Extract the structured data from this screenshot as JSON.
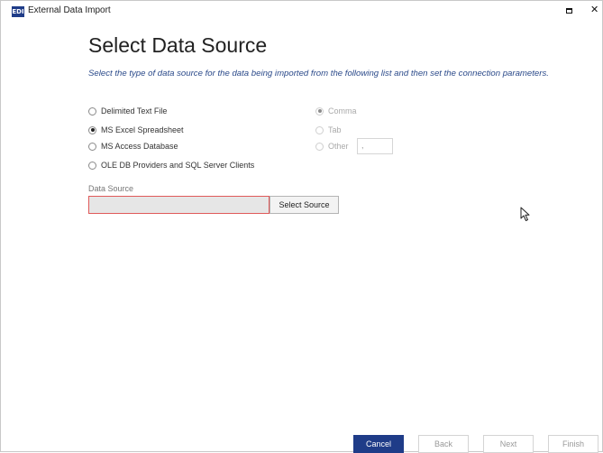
{
  "window": {
    "title": "External Data Import",
    "app_icon_text": "EDI"
  },
  "page": {
    "heading": "Select Data Source",
    "instructions": "Select the type of data source for the data being imported from the following list and then set the connection parameters."
  },
  "source_types": [
    {
      "label": "Delimited Text File",
      "checked": false
    },
    {
      "label": "MS Excel Spreadsheet",
      "checked": true
    },
    {
      "label": "MS Access Database",
      "checked": false
    },
    {
      "label": "OLE DB Providers and SQL Server Clients",
      "checked": false
    }
  ],
  "delimiters": [
    {
      "label": "Comma",
      "checked": true,
      "disabled": true
    },
    {
      "label": "Tab",
      "checked": false,
      "disabled": true
    },
    {
      "label": "Other",
      "checked": false,
      "disabled": true
    }
  ],
  "other_delimiter_value": ",",
  "data_source": {
    "label": "Data Source",
    "value": "",
    "button_label": "Select Source"
  },
  "footer": {
    "cancel": "Cancel",
    "back": "Back",
    "next": "Next",
    "finish": "Finish"
  },
  "colors": {
    "accent": "#1f3c88",
    "instruction_text": "#2b4a8a",
    "error_border": "#e05a5a"
  }
}
